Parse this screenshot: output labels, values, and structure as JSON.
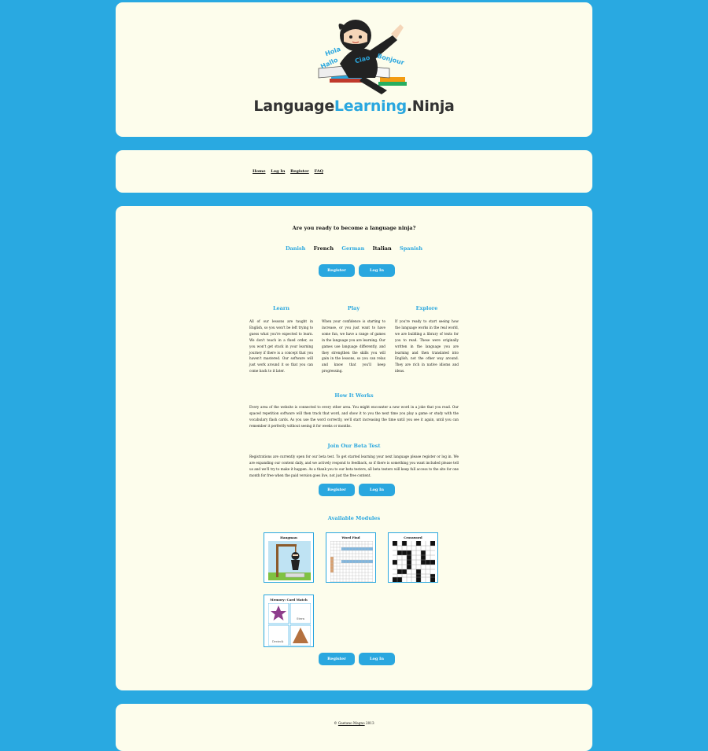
{
  "logo": {
    "word_plain": "Language",
    "word_blue": "Learning",
    "word_end": ".Ninja",
    "bubbles": [
      "Hola",
      "Hallo",
      "Ciao",
      "Bonjour"
    ]
  },
  "nav": {
    "items": [
      {
        "label": "Home"
      },
      {
        "label": "Log In"
      },
      {
        "label": "Register"
      },
      {
        "label": "FAQ"
      }
    ]
  },
  "main": {
    "headline": "Are you ready to become a language ninja?",
    "languages": [
      {
        "label": "Danish",
        "link": true
      },
      {
        "label": "French",
        "link": false
      },
      {
        "label": "German",
        "link": true
      },
      {
        "label": "Italian",
        "link": false
      },
      {
        "label": "Spanish",
        "link": true
      }
    ],
    "buttons": {
      "register": "Register",
      "login": "Log In"
    },
    "columns": [
      {
        "title": "Learn",
        "text": "All of our lessons are taught in English, so you won't be left trying to guess what you're expected to learn. We don't teach in a fixed order, so you won't get stuck in your learning journey if there is a concept that you haven't mastered. Our software will just work around it so that you can come back to it later."
      },
      {
        "title": "Play",
        "text": "When your confidence is starting to increase, or you just want to have some fun, we have a range of games in the language you are learning. Our games use language differently, and they strengthen the skills you will gain in the lessons, so you can relax and know that you'll keep progressing."
      },
      {
        "title": "Explore",
        "text": "If you're ready to start seeing how the language works in the real world, we are building a library of texts for you to read. These were originally written in the language you are learning and then translated into English, not the other way around. They are rich in native idioms and ideas."
      }
    ],
    "how": {
      "title": "How It Works",
      "text": "Every area of the website is connected to every other area. You might encounter a new word in a joke that you read. Our spaced repetition software will then track that word, and show it to you the next time you play a game or study with the vocabulary flash cards. As you use the word correctly, we'll start increasing the time until you see it again, until you can remember it perfectly without seeing it for weeks or months."
    },
    "beta": {
      "title": "Join Our Beta Test",
      "text": "Registrations are currently open for our beta test. To get started learning your next language please register or log in. We are expanding our content daily, and we actively respond to feedback, so if there is something you want included please tell us and we'll try to make it happen. As a thank you to our beta testers, all beta testers will keep full access to the site for one month for free when the paid version goes live, not just the free content."
    },
    "modules": {
      "title": "Available Modules",
      "items": [
        {
          "label": "Hangman",
          "icon": "hangman-thumbnail"
        },
        {
          "label": "Word Find",
          "icon": "wordfind-thumbnail"
        },
        {
          "label": "Crossword",
          "icon": "crossword-thumbnail"
        },
        {
          "label": "Memory: Card Match",
          "icon": "memory-thumbnail",
          "cards": [
            "Stern",
            "Dreieck"
          ]
        }
      ]
    }
  },
  "footer": {
    "prefix": "© ",
    "link": "Gaetano Magno",
    "suffix": " 2013"
  },
  "colors": {
    "background": "#29a9e1",
    "panel": "#fdfdec",
    "accent": "#2aa7df"
  }
}
